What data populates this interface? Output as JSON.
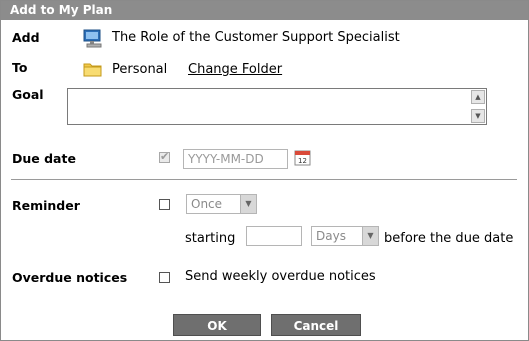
{
  "dialog": {
    "title": "Add to My Plan"
  },
  "form": {
    "add_label": "Add",
    "add_value": "The Role of the Customer Support Specialist",
    "to_label": "To",
    "to_value": "Personal",
    "change_folder": "Change Folder",
    "goal_label": "Goal",
    "goal_value": "",
    "due_date_label": "Due date",
    "due_date_checked": true,
    "due_date_placeholder": "YYYY-MM-DD",
    "reminder_label": "Reminder",
    "reminder_checked": false,
    "reminder_frequency": "Once",
    "starting_label": "starting",
    "starting_value": "",
    "starting_unit": "Days",
    "before_due_text": "before the due date",
    "overdue_label": "Overdue notices",
    "overdue_checked": false,
    "overdue_text": "Send weekly overdue notices"
  },
  "buttons": {
    "ok": "OK",
    "cancel": "Cancel"
  },
  "icons": {
    "add": "monitor-icon",
    "to": "folder-icon",
    "due_date": "calendar-icon"
  },
  "colors": {
    "titlebar": "#8c8c8c",
    "button": "#6f6f6f",
    "folder": "#f2c94c"
  }
}
